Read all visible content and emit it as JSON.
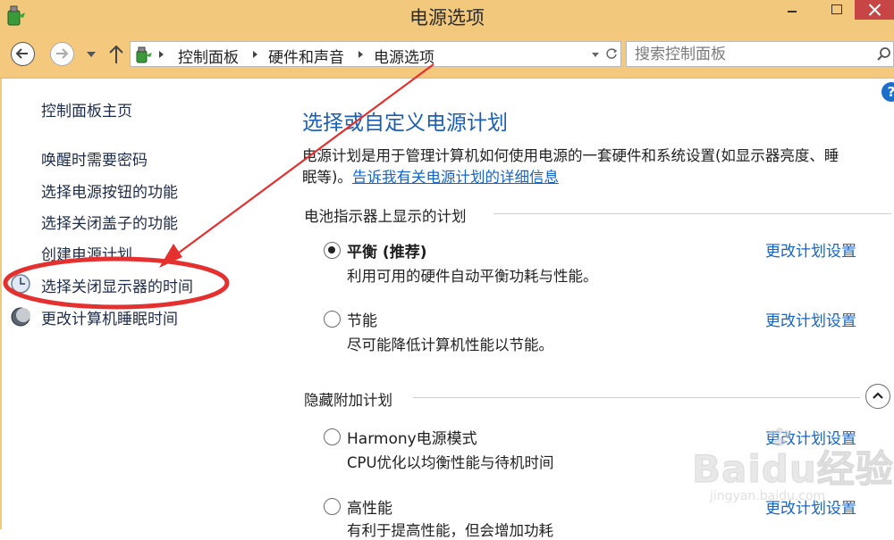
{
  "window": {
    "title": "电源选项"
  },
  "address_bar": {
    "breadcrumbs": [
      "控制面板",
      "硬件和声音",
      "电源选项"
    ],
    "search_placeholder": "搜索控制面板"
  },
  "sidebar": {
    "home": "控制面板主页",
    "links": [
      "唤醒时需要密码",
      "选择电源按钮的功能",
      "选择关闭盖子的功能",
      "创建电源计划",
      "选择关闭显示器的时间",
      "更改计算机睡眠时间"
    ]
  },
  "main": {
    "title": "选择或自定义电源计划",
    "description_line1": "电源计划是用于管理计算机如何使用电源的一套硬件和系统设置(如显示器亮度、睡",
    "description_line2_prefix": "眠等)。",
    "description_link": "告诉我有关电源计划的详细信息",
    "battery_section": {
      "heading": "电池指示器上显示的计划",
      "plans": [
        {
          "name": "平衡 (推荐)",
          "desc": "利用可用的硬件自动平衡功耗与性能。",
          "selected": true,
          "link": "更改计划设置"
        },
        {
          "name": "节能",
          "desc": "尽可能降低计算机性能以节能。",
          "selected": false,
          "link": "更改计划设置"
        }
      ]
    },
    "hidden_section": {
      "heading": "隐藏附加计划",
      "plans": [
        {
          "name": "Harmony电源模式",
          "desc": "CPU优化以均衡性能与待机时间",
          "selected": false,
          "link": "更改计划设置"
        },
        {
          "name": "高性能",
          "desc": "有利于提高性能，但会增加功耗",
          "selected": false,
          "link": "更改计划设置"
        }
      ]
    }
  },
  "watermark": {
    "logo": "Baidu经验",
    "url": "jingyan.baidu.com"
  },
  "colors": {
    "titlebar": "#f2c87c",
    "link": "#1565c8",
    "title": "#1a5fb4",
    "annotation": "#e53030"
  }
}
